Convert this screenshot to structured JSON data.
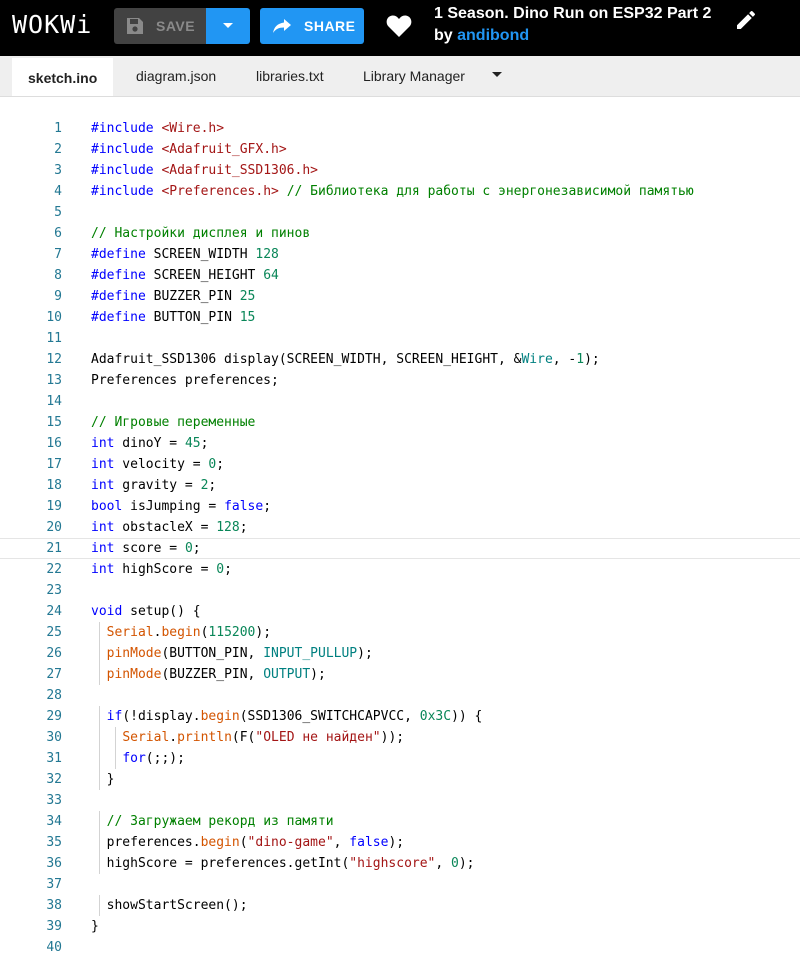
{
  "app": {
    "logo": "WOKWi"
  },
  "toolbar": {
    "save_label": "SAVE",
    "share_label": "SHARE"
  },
  "project": {
    "title": "1 Season. Dino Run on ESP32 Part 2",
    "by_prefix": "by ",
    "author": "andibond"
  },
  "tabs": [
    {
      "label": "sketch.ino",
      "active": true
    },
    {
      "label": "diagram.json"
    },
    {
      "label": "libraries.txt"
    },
    {
      "label": "Library Manager"
    }
  ],
  "editor": {
    "current_line": 21,
    "lines": [
      {
        "n": "1",
        "code": "#include <Wire.h>"
      },
      {
        "n": "2",
        "code": "#include <Adafruit_GFX.h>"
      },
      {
        "n": "3",
        "code": "#include <Adafruit_SSD1306.h>"
      },
      {
        "n": "4",
        "code": "#include <Preferences.h> // Библиотека для работы с энергонезависимой памятью"
      },
      {
        "n": "5",
        "code": ""
      },
      {
        "n": "6",
        "code": "// Настройки дисплея и пинов"
      },
      {
        "n": "7",
        "code": "#define SCREEN_WIDTH 128"
      },
      {
        "n": "8",
        "code": "#define SCREEN_HEIGHT 64"
      },
      {
        "n": "9",
        "code": "#define BUZZER_PIN 25"
      },
      {
        "n": "10",
        "code": "#define BUTTON_PIN 15"
      },
      {
        "n": "11",
        "code": ""
      },
      {
        "n": "12",
        "code": "Adafruit_SSD1306 display(SCREEN_WIDTH, SCREEN_HEIGHT, &Wire, -1);"
      },
      {
        "n": "13",
        "code": "Preferences preferences;"
      },
      {
        "n": "14",
        "code": ""
      },
      {
        "n": "15",
        "code": "// Игровые переменные"
      },
      {
        "n": "16",
        "code": "int dinoY = 45;"
      },
      {
        "n": "17",
        "code": "int velocity = 0;"
      },
      {
        "n": "18",
        "code": "int gravity = 2;"
      },
      {
        "n": "19",
        "code": "bool isJumping = false;"
      },
      {
        "n": "20",
        "code": "int obstacleX = 128;"
      },
      {
        "n": "21",
        "code": "int score = 0;"
      },
      {
        "n": "22",
        "code": "int highScore = 0;"
      },
      {
        "n": "23",
        "code": ""
      },
      {
        "n": "24",
        "code": "void setup() {"
      },
      {
        "n": "25",
        "code": "  Serial.begin(115200);"
      },
      {
        "n": "26",
        "code": "  pinMode(BUTTON_PIN, INPUT_PULLUP);"
      },
      {
        "n": "27",
        "code": "  pinMode(BUZZER_PIN, OUTPUT);"
      },
      {
        "n": "28",
        "code": ""
      },
      {
        "n": "29",
        "code": "  if(!display.begin(SSD1306_SWITCHCAPVCC, 0x3C)) {"
      },
      {
        "n": "30",
        "code": "    Serial.println(F(\"OLED не найден\"));"
      },
      {
        "n": "31",
        "code": "    for(;;);"
      },
      {
        "n": "32",
        "code": "  }"
      },
      {
        "n": "33",
        "code": ""
      },
      {
        "n": "34",
        "code": "  // Загружаем рекорд из памяти"
      },
      {
        "n": "35",
        "code": "  preferences.begin(\"dino-game\", false);"
      },
      {
        "n": "36",
        "code": "  highScore = preferences.getInt(\"highscore\", 0);"
      },
      {
        "n": "37",
        "code": ""
      },
      {
        "n": "38",
        "code": "  showStartScreen();"
      },
      {
        "n": "39",
        "code": "}"
      },
      {
        "n": "40",
        "code": ""
      }
    ]
  },
  "icons": {
    "save": "floppy-disk-icon",
    "dropdown": "caret-down-icon",
    "share": "share-arrow-icon",
    "like": "heart-icon",
    "edit": "pencil-icon",
    "tab_menu": "caret-down-icon"
  },
  "colors": {
    "topbar_bg": "#000000",
    "accent": "#2196f3",
    "save_bg": "#424242",
    "tabbar_bg": "#efefef",
    "line_number": "#237893"
  }
}
